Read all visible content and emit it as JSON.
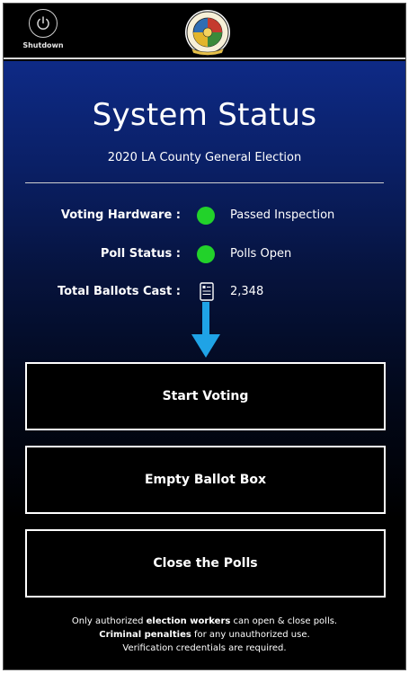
{
  "header": {
    "shutdown_label": "Shutdown",
    "seal_icon": "la-county-seal-icon"
  },
  "main": {
    "title": "System Status",
    "subtitle": "2020 LA County General Election",
    "status": [
      {
        "label": "Voting Hardware :",
        "indicator": "green-dot",
        "value": "Passed Inspection"
      },
      {
        "label": "Poll Status :",
        "indicator": "green-dot",
        "value": "Polls Open"
      },
      {
        "label": "Total Ballots Cast :",
        "indicator": "ballot-icon",
        "value": "2,348"
      }
    ],
    "arrow_icon": "down-arrow-icon"
  },
  "actions": {
    "start_voting": "Start Voting",
    "empty_ballot_box": "Empty Ballot Box",
    "close_polls": "Close the Polls"
  },
  "footer": {
    "line1_pre": "Only authorized ",
    "line1_bold": "election workers",
    "line1_post": " can open & close polls.",
    "line2_bold": "Criminal penalties",
    "line2_post": " for any unauthorized use.",
    "line3": "Verification credentials are required."
  },
  "colors": {
    "status_ok": "#22d22a",
    "arrow": "#1fa3e6",
    "gradient_top": "#0e2a86",
    "background": "#000000"
  }
}
